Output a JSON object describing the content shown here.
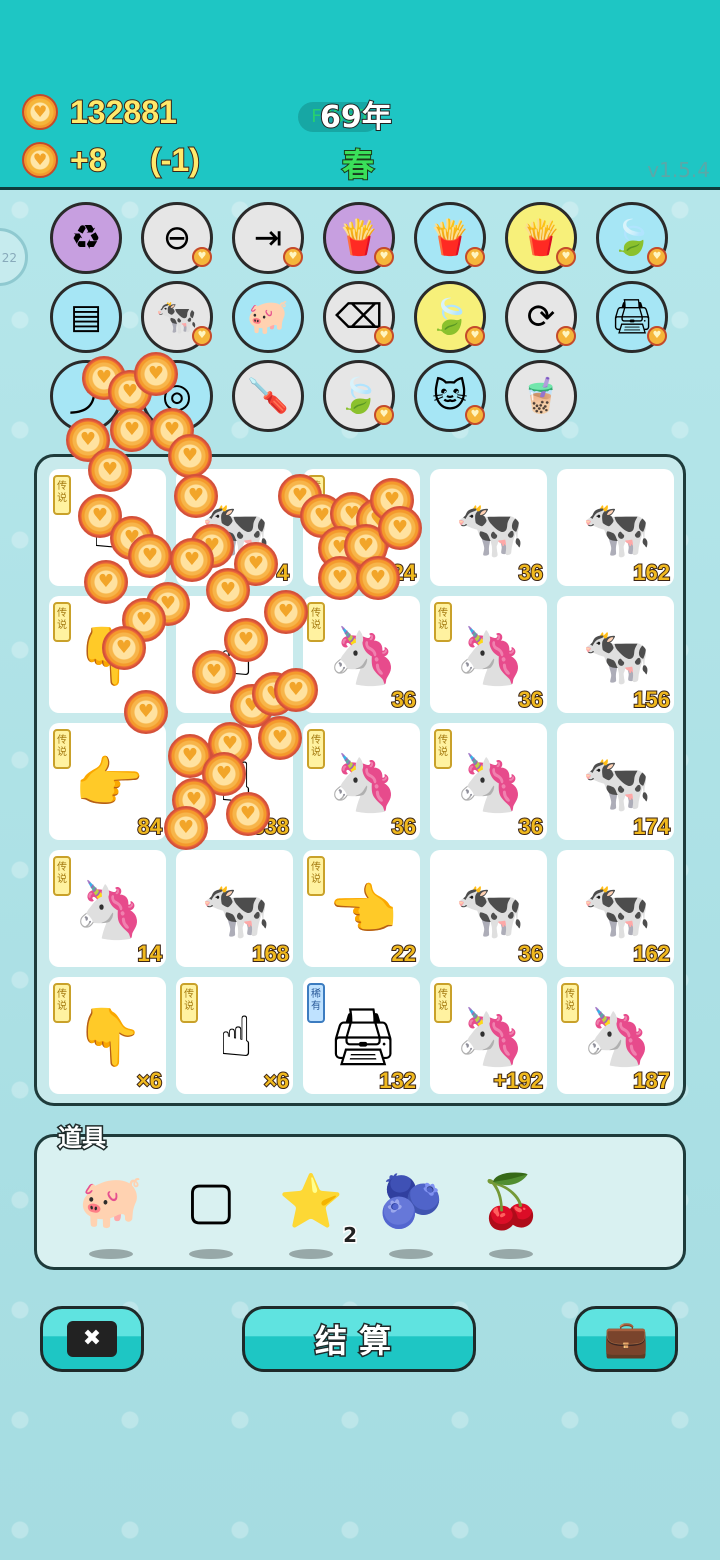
{
  "header": {
    "coins": "132881",
    "income": "+8",
    "income_change": "(-1)",
    "year": "69年",
    "fps": "FPS60",
    "season": "春",
    "version": "v1.5.4"
  },
  "side_indicator": "22",
  "abilities": [
    {
      "name": "recycle-icon",
      "glyph": "♻",
      "bg": "#c79fe0"
    },
    {
      "name": "remove-icon",
      "glyph": "⊖",
      "bg": "#e6e6e6"
    },
    {
      "name": "skip-icon",
      "glyph": "⇥",
      "bg": "#e6e6e6"
    },
    {
      "name": "fries-icon",
      "glyph": "🍟",
      "bg": "#c79fe0"
    },
    {
      "name": "fries-icon",
      "glyph": "🍟",
      "bg": "#a6e6f5"
    },
    {
      "name": "fries-icon",
      "glyph": "🍟",
      "bg": "#f7f07a"
    },
    {
      "name": "leaf-icon",
      "glyph": "🍃",
      "bg": "#a6e6f5"
    },
    {
      "name": "skirt-icon",
      "glyph": "▤",
      "bg": "#a6e6f5"
    },
    {
      "name": "cow-pair-icon",
      "glyph": "🐄",
      "bg": "#e6e6e6"
    },
    {
      "name": "piggy-bank-icon",
      "glyph": "🐖",
      "bg": "#a6e6f5"
    },
    {
      "name": "delete-tag-icon",
      "glyph": "⌫",
      "bg": "#e6e6e6"
    },
    {
      "name": "leaf-icon",
      "glyph": "🍃",
      "bg": "#f7f07a"
    },
    {
      "name": "refresh-icon",
      "glyph": "⟳",
      "bg": "#e6e6e6"
    },
    {
      "name": "printer-icon",
      "glyph": "🖨",
      "bg": "#a6e6f5"
    },
    {
      "name": "arrow-box-icon",
      "glyph": "⤴",
      "bg": "#a6e6f5"
    },
    {
      "name": "coin-stack-icon",
      "glyph": "◎",
      "bg": "#a6e6f5"
    },
    {
      "name": "screwdriver-icon",
      "glyph": "🪛",
      "bg": "#e6e6e6"
    },
    {
      "name": "leaf-icon",
      "glyph": "🍃",
      "bg": "#e6e6e6"
    },
    {
      "name": "cat-icon",
      "glyph": "🐱",
      "bg": "#a6e6f5"
    },
    {
      "name": "bubble-tea-icon",
      "glyph": "🧋",
      "bg": "#e6e6e6"
    }
  ],
  "board": [
    {
      "tag": "传说",
      "icon": "pointing-hand-icon",
      "glyph": "☝",
      "value": ""
    },
    {
      "tag": "",
      "icon": "cow-icon",
      "glyph": "🐄",
      "value": "4"
    },
    {
      "tag": "传说",
      "icon": "unicorn-icon",
      "glyph": "🦄",
      "value": "24"
    },
    {
      "tag": "",
      "icon": "cow-icon",
      "glyph": "🐄",
      "value": "36"
    },
    {
      "tag": "",
      "icon": "cow-icon",
      "glyph": "🐄",
      "value": "162"
    },
    {
      "tag": "传说",
      "icon": "pointing-hand-icon",
      "glyph": "👇",
      "value": ""
    },
    {
      "tag": "",
      "icon": "pointing-hand-icon",
      "glyph": "☝",
      "value": ""
    },
    {
      "tag": "传说",
      "icon": "unicorn-icon",
      "glyph": "🦄",
      "value": "36"
    },
    {
      "tag": "传说",
      "icon": "unicorn-icon",
      "glyph": "🦄",
      "value": "36"
    },
    {
      "tag": "",
      "icon": "cow-icon",
      "glyph": "🐄",
      "value": "156"
    },
    {
      "tag": "传说",
      "icon": "pointing-hand-icon",
      "glyph": "👉",
      "value": "84"
    },
    {
      "tag": "",
      "icon": "pointing-hand-icon",
      "glyph": "☝",
      "value": "+338"
    },
    {
      "tag": "传说",
      "icon": "unicorn-icon",
      "glyph": "🦄",
      "value": "36"
    },
    {
      "tag": "传说",
      "icon": "unicorn-icon",
      "glyph": "🦄",
      "value": "36"
    },
    {
      "tag": "",
      "icon": "cow-icon",
      "glyph": "🐄",
      "value": "174"
    },
    {
      "tag": "传说",
      "icon": "unicorn-icon",
      "glyph": "🦄",
      "value": "14"
    },
    {
      "tag": "",
      "icon": "cow-icon",
      "glyph": "🐄",
      "value": "168"
    },
    {
      "tag": "传说",
      "icon": "pointing-hand-icon",
      "glyph": "👈",
      "value": "22"
    },
    {
      "tag": "",
      "icon": "cow-icon",
      "glyph": "🐄",
      "value": "36"
    },
    {
      "tag": "",
      "icon": "cow-icon",
      "glyph": "🐄",
      "value": "162"
    },
    {
      "tag": "传说",
      "icon": "pointing-hand-icon",
      "glyph": "👇",
      "value": "×6"
    },
    {
      "tag": "传说",
      "icon": "pointing-hand-icon",
      "glyph": "☝",
      "value": "×6"
    },
    {
      "tag": "稀有",
      "icon": "printer-icon",
      "glyph": "🖨",
      "value": "132"
    },
    {
      "tag": "传说",
      "icon": "unicorn-icon",
      "glyph": "🦄",
      "value": "+192"
    },
    {
      "tag": "传说",
      "icon": "unicorn-icon",
      "glyph": "🦄",
      "value": "187"
    }
  ],
  "items": {
    "label": "道具",
    "list": [
      {
        "name": "piggy-bank-icon",
        "glyph": "🐖",
        "count": ""
      },
      {
        "name": "frame-icon",
        "glyph": "▢",
        "count": ""
      },
      {
        "name": "star-icon",
        "glyph": "⭐",
        "count": "2"
      },
      {
        "name": "blueberry-icon",
        "glyph": "🫐",
        "count": ""
      },
      {
        "name": "bayberry-icon",
        "glyph": "🍒",
        "count": ""
      }
    ]
  },
  "buttons": {
    "remove_glyph": "✖",
    "settle_label": "结算",
    "bag_glyph": "💼"
  }
}
